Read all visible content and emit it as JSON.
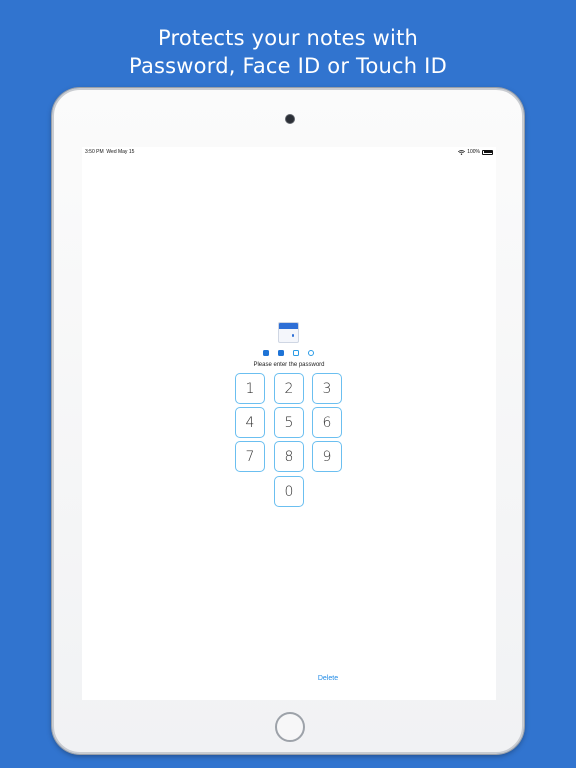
{
  "headline": {
    "line1": "Protects your notes with",
    "line2": "Password, Face ID or Touch ID"
  },
  "status_bar": {
    "time": "3:50 PM",
    "date": "Wed May 15",
    "battery": "100%",
    "icons": [
      "wifi-icon",
      "battery-icon"
    ]
  },
  "lock": {
    "icon": "lock-icon",
    "entered_digits": 2,
    "total_digits": 4,
    "prompt": "Please enter the password"
  },
  "keypad": {
    "keys": [
      "1",
      "2",
      "3",
      "4",
      "5",
      "6",
      "7",
      "8",
      "9",
      "0"
    ]
  },
  "actions": {
    "delete_label": "Delete"
  },
  "colors": {
    "background": "#3174cf",
    "accent": "#1e73d6",
    "key_border": "#6bbff0"
  }
}
